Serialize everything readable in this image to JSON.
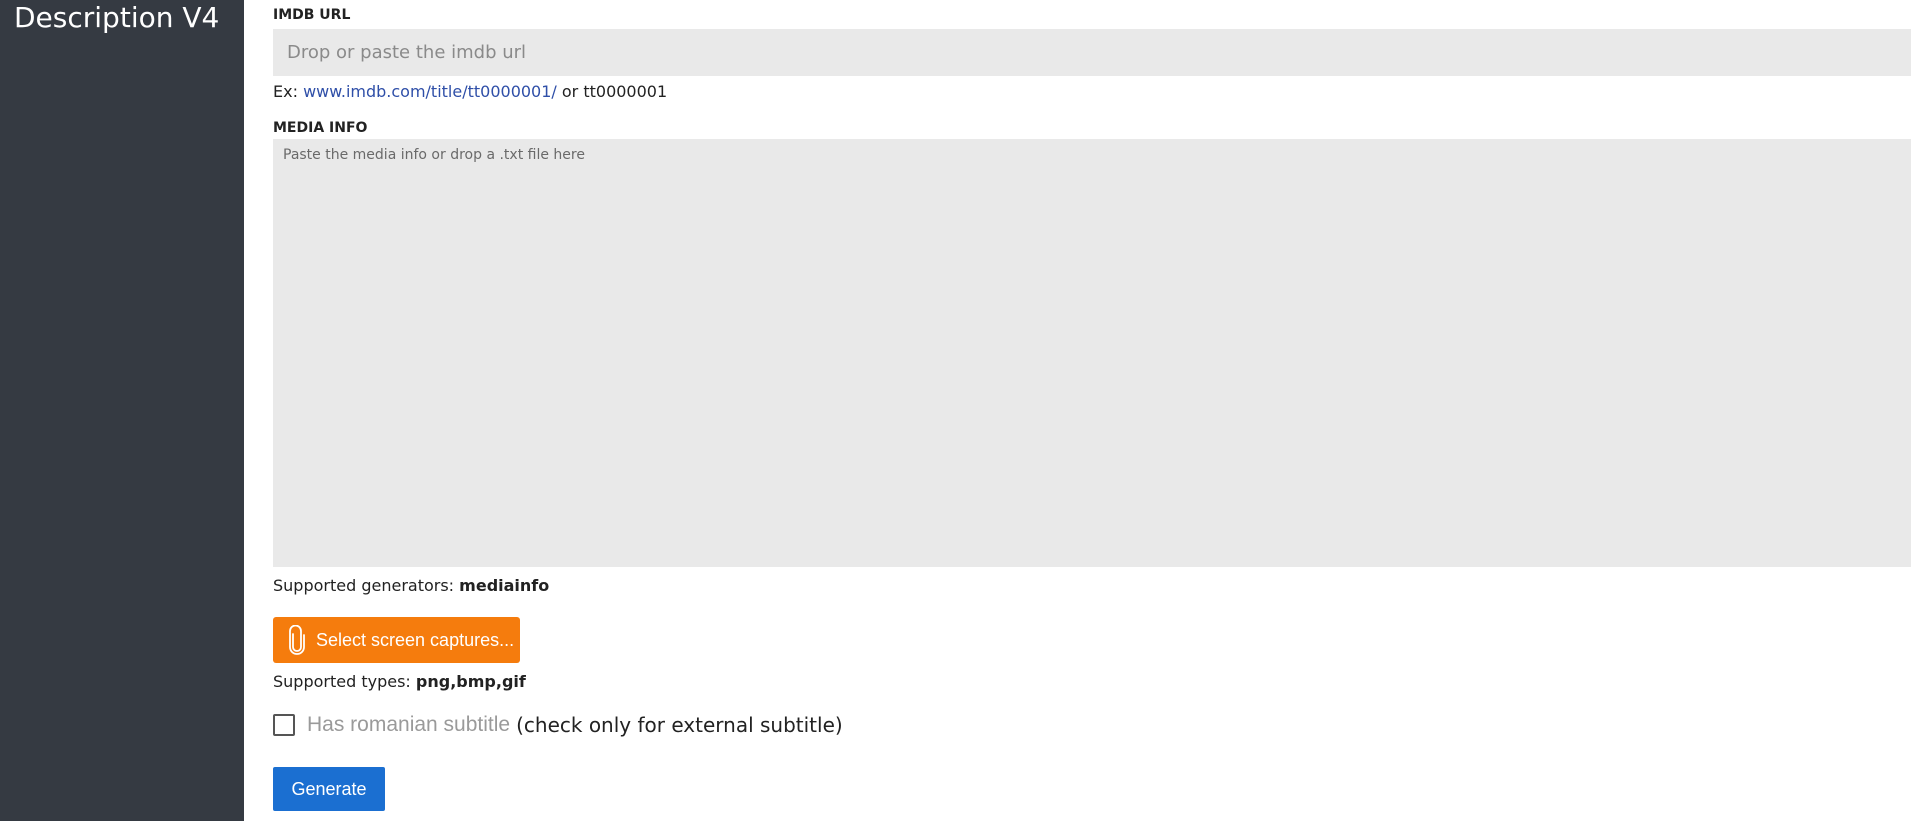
{
  "sidebar": {
    "title": "Description V4",
    "background": "#353a42"
  },
  "imdb": {
    "label": "IMDB URL",
    "placeholder": "Drop or paste the imdb url",
    "value": "",
    "example_prefix": "Ex:",
    "example_link": "www.imdb.com/title/tt0000001/",
    "example_suffix": "or tt0000001"
  },
  "media_info": {
    "label": "MEDIA INFO",
    "placeholder": "Paste the media info or drop a .txt file here",
    "value": "",
    "supported_prefix": "Supported generators:",
    "supported_value": "mediainfo"
  },
  "screens": {
    "button_label": "Select screen captures...",
    "button_icon": "paperclip-icon",
    "button_color": "#f57c0d",
    "supported_prefix": "Supported types:",
    "supported_value": "png,bmp,gif"
  },
  "subtitle": {
    "checked": false,
    "label": "Has romanian subtitle",
    "note": "(check only for external subtitle)"
  },
  "generate": {
    "label": "Generate",
    "color": "#1b6fd1"
  }
}
